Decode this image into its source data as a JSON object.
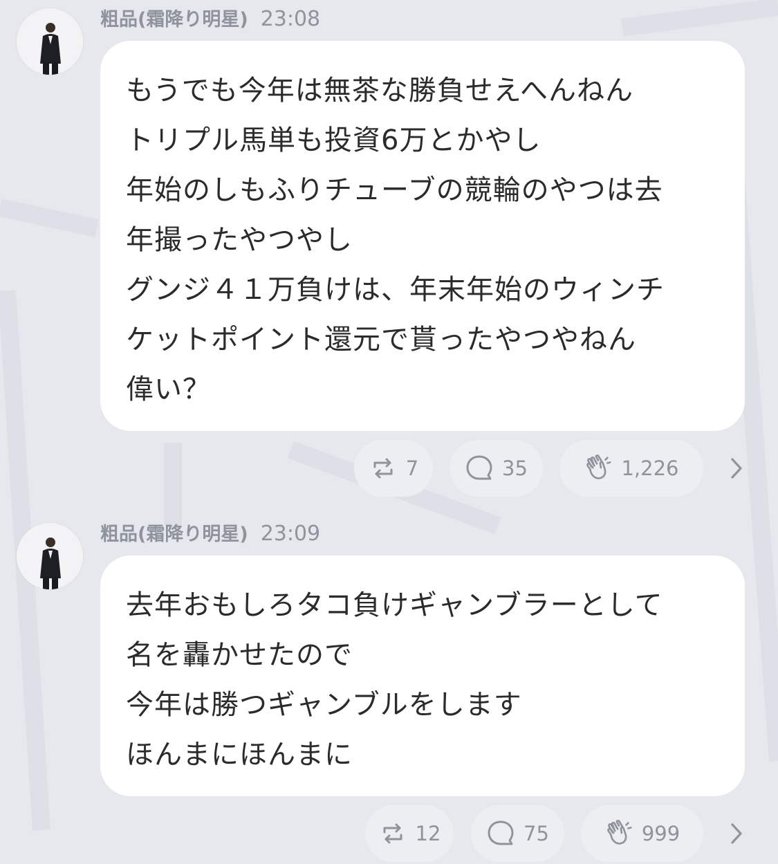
{
  "messages": [
    {
      "author": "粗品(霜降り明星)",
      "time": "23:08",
      "lines": [
        "もうでも今年は無茶な勝負せえへんねん",
        "トリプル馬単も投資6万とかやし",
        "年始のしもふりチューブの競輪のやつは去",
        "年撮ったやつやし",
        "グンジ４１万負けは、年末年始のウィンチ",
        "ケットポイント還元で貰ったやつやねん",
        "偉い？"
      ],
      "repost_count": "7",
      "reply_count": "35",
      "clap_count": "1,226"
    },
    {
      "author": "粗品(霜降り明星)",
      "time": "23:09",
      "lines": [
        "去年おもしろタコ負けギャンブラーとして",
        "名を轟かせたので",
        "今年は勝つギャンブルをします",
        "ほんまにほんまに"
      ],
      "repost_count": "12",
      "reply_count": "75",
      "clap_count": "999"
    }
  ],
  "icons": {
    "repost": "repost-icon",
    "reply": "speech-bubble-icon",
    "clap": "clapping-hands-icon",
    "more": "chevron-right-icon"
  },
  "colors": {
    "background": "#e6e8ee",
    "bubble": "#ffffff",
    "meta_text": "#8e939c",
    "body_text": "#2b2b2b",
    "pill": "#eceef2"
  }
}
